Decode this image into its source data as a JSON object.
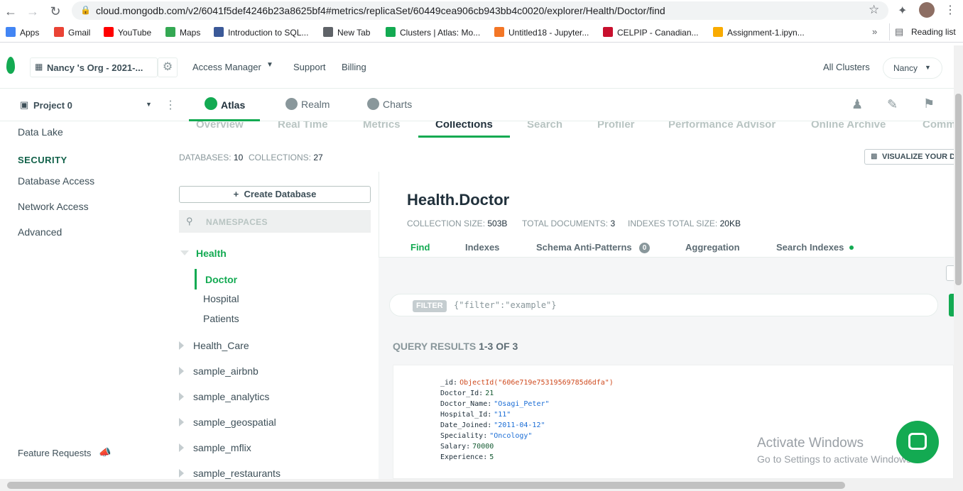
{
  "browser": {
    "url": "cloud.mongodb.com/v2/6041f5def4246b23a8625bf4#metrics/replicaSet/60449cea906cb943bb4c0020/explorer/Health/Doctor/find",
    "bookmarks": [
      {
        "label": "Apps",
        "color": "#4285f4"
      },
      {
        "label": "Gmail",
        "color": "#ea4335"
      },
      {
        "label": "YouTube",
        "color": "#ff0000"
      },
      {
        "label": "Maps",
        "color": "#34a853"
      },
      {
        "label": "Introduction to SQL...",
        "color": "#3b5998"
      },
      {
        "label": "New Tab",
        "color": "#5f6368"
      },
      {
        "label": "Clusters | Atlas: Mo...",
        "color": "#13aa52"
      },
      {
        "label": "Untitled18 - Jupyter...",
        "color": "#f37626"
      },
      {
        "label": "CELPIP - Canadian...",
        "color": "#c8102e"
      },
      {
        "label": "Assignment-1.ipyn...",
        "color": "#f9ab00"
      }
    ],
    "more": "»",
    "reading_list": "Reading list"
  },
  "topbar": {
    "org": "Nancy 's Org - 2021-...",
    "access_manager": "Access Manager",
    "support": "Support",
    "billing": "Billing",
    "all_clusters": "All Clusters",
    "user": "Nancy"
  },
  "projbar": {
    "project": "Project 0",
    "tabs": [
      "Atlas",
      "Realm",
      "Charts"
    ]
  },
  "sidebar": {
    "data_lake": "Data Lake",
    "security_heading": "SECURITY",
    "database_access": "Database Access",
    "network_access": "Network Access",
    "advanced": "Advanced",
    "feature_requests": "Feature Requests"
  },
  "subnav": [
    "Overview",
    "Real Time",
    "Metrics",
    "Collections",
    "Search",
    "Profiler",
    "Performance Advisor",
    "Online Archive",
    "Comm"
  ],
  "stats": {
    "databases_label": "DATABASES:",
    "databases_value": "10",
    "collections_label": "COLLECTIONS:",
    "collections_value": "27",
    "visualize": "VISUALIZE YOUR D"
  },
  "db_panel": {
    "create_database": "Create Database",
    "namespaces_placeholder": "NAMESPACES",
    "open_db": "Health",
    "collections": [
      "Doctor",
      "Hospital",
      "Patients"
    ],
    "other_dbs": [
      "Health_Care",
      "sample_airbnb",
      "sample_analytics",
      "sample_geospatial",
      "sample_mflix",
      "sample_restaurants"
    ]
  },
  "collection": {
    "title": "Health.Doctor",
    "size_label": "COLLECTION SIZE:",
    "size_value": "503B",
    "docs_label": "TOTAL DOCUMENTS:",
    "docs_value": "3",
    "idx_label": "INDEXES TOTAL SIZE:",
    "idx_value": "20KB",
    "tabs": {
      "find": "Find",
      "indexes": "Indexes",
      "schema": "Schema Anti-Patterns",
      "schema_count": "0",
      "aggregation": "Aggregation",
      "search_indexes": "Search Indexes"
    },
    "filter_badge": "FILTER",
    "filter_placeholder": "{\"filter\":\"example\"}",
    "results_label": "QUERY RESULTS",
    "results_range": "1-3 OF 3"
  },
  "document": [
    {
      "key": "_id:",
      "value": "ObjectId(\"606e719e75319569785d6dfa\")",
      "kind": "oid"
    },
    {
      "key": "Doctor_Id:",
      "value": "21",
      "kind": "num"
    },
    {
      "key": "Doctor_Name:",
      "value": "\"Osagi_Peter\"",
      "kind": "str"
    },
    {
      "key": "Hospital_Id:",
      "value": "\"11\"",
      "kind": "str"
    },
    {
      "key": "Date_Joined:",
      "value": "\"2011-04-12\"",
      "kind": "str"
    },
    {
      "key": "Speciality:",
      "value": "\"Oncology\"",
      "kind": "str"
    },
    {
      "key": "Salary:",
      "value": "70000",
      "kind": "num"
    },
    {
      "key": "Experience:",
      "value": "5",
      "kind": "num"
    }
  ],
  "watermark": {
    "line1": "Activate Windows",
    "line2": "Go to Settings to activate Windows."
  },
  "colors": {
    "accent": "#13aa52",
    "chat": "#13aa52"
  }
}
